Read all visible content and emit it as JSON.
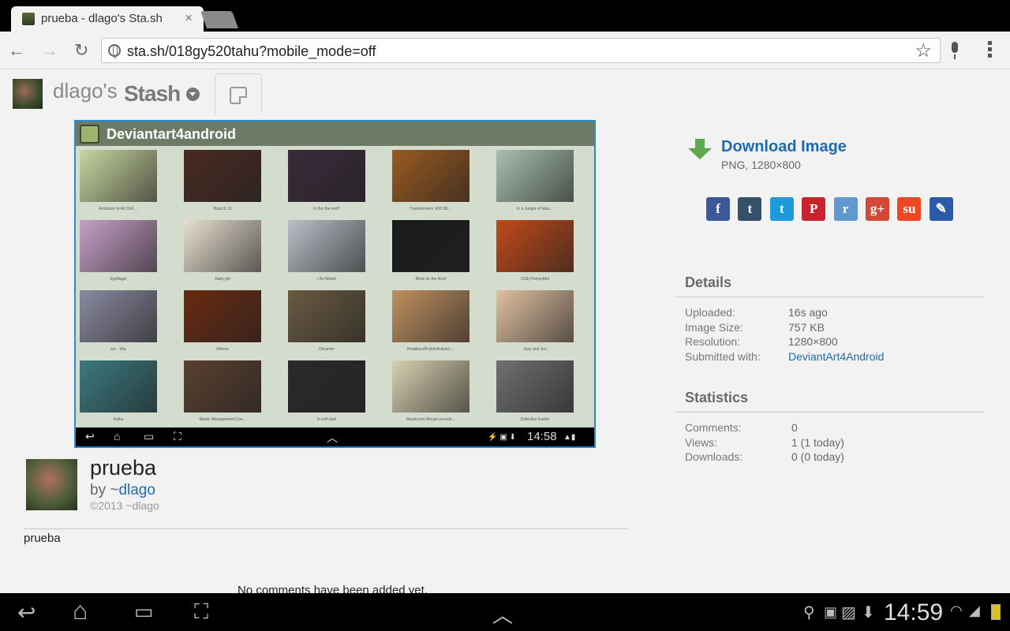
{
  "browser": {
    "tab_title": "prueba - dlago's Sta.sh",
    "tab_close": "×",
    "url": "sta.sh/018gy520tahu?mobile_mode=off"
  },
  "stash": {
    "user": "dlago's",
    "title": "Stash"
  },
  "preview": {
    "app_name": "Deviantart4android",
    "thumbnails": [
      {
        "caption": "Armature to Art Doll ...",
        "color": "#c9d6a0"
      },
      {
        "caption": "Brunch 13",
        "color": "#4a2a22"
      },
      {
        "caption": "Is this the end?",
        "color": "#3a2a3a"
      },
      {
        "caption": "Transformers: RID 98 ...",
        "color": "#9a5a20"
      },
      {
        "caption": "In a Jungle of Islan...",
        "color": "#a8c0b0"
      },
      {
        "caption": "Egoflagie",
        "color": "#c8a0c8"
      },
      {
        "caption": "Baby girl",
        "color": "#e8e0d0"
      },
      {
        "caption": "I Art Model",
        "color": "#b8c0c8"
      },
      {
        "caption": "Birds on the Roof",
        "color": "#1a1a1a"
      },
      {
        "caption": "(CM) PomeyMel",
        "color": "#c04a1a"
      },
      {
        "caption": "Ice - Mia",
        "color": "#8a8aa0"
      },
      {
        "caption": "Inferno",
        "color": "#6a2a10"
      },
      {
        "caption": "Dreamer",
        "color": "#6a5a40"
      },
      {
        "caption": "HeadbandPolish/Autumn ...",
        "color": "#c09060"
      },
      {
        "caption": "Joey and Jen",
        "color": "#e0c0a0"
      },
      {
        "caption": "Kaiku",
        "color": "#3a7a80"
      },
      {
        "caption": "Waste Management Con...",
        "color": "#5a4030"
      },
      {
        "caption": "in soft dark",
        "color": "#2a2a2a"
      },
      {
        "caption": "Mushroom Mouse encode...",
        "color": "#d8d0b0"
      },
      {
        "caption": "Defective Easter",
        "color": "#707070"
      }
    ],
    "status_time": "14:58"
  },
  "deviation": {
    "title": "prueba",
    "by": "by ~",
    "author": "dlago",
    "copyright": "©2013 ~dlago",
    "description": "prueba",
    "no_comments": "No comments have been added yet."
  },
  "download": {
    "label": "Download Image",
    "meta": "PNG, 1280×800"
  },
  "share_buttons": [
    {
      "name": "facebook",
      "glyph": "f",
      "color": "#3b5998"
    },
    {
      "name": "tumblr",
      "glyph": "t",
      "color": "#35506b"
    },
    {
      "name": "twitter",
      "glyph": "t",
      "color": "#1d9ad8"
    },
    {
      "name": "pinterest",
      "glyph": "P",
      "color": "#c8232c"
    },
    {
      "name": "reddit",
      "glyph": "r",
      "color": "#5f99cf"
    },
    {
      "name": "google-plus",
      "glyph": "g+",
      "color": "#d34836"
    },
    {
      "name": "stumbleupon",
      "glyph": "su",
      "color": "#eb4823"
    },
    {
      "name": "edit",
      "glyph": "✎",
      "color": "#2b5aa8"
    }
  ],
  "details": {
    "title": "Details",
    "rows": [
      {
        "label": "Uploaded:",
        "value": "16s ago"
      },
      {
        "label": "Image Size:",
        "value": "757 KB"
      },
      {
        "label": "Resolution:",
        "value": "1280×800"
      },
      {
        "label": "Submitted with:",
        "value": "DeviantArt4Android"
      }
    ]
  },
  "statistics": {
    "title": "Statistics",
    "rows": [
      {
        "label": "Comments:",
        "value": "0"
      },
      {
        "label": "Views:",
        "value": "1 (1 today)"
      },
      {
        "label": "Downloads:",
        "value": "0 (0 today)"
      }
    ]
  },
  "system": {
    "time": "14:59"
  }
}
